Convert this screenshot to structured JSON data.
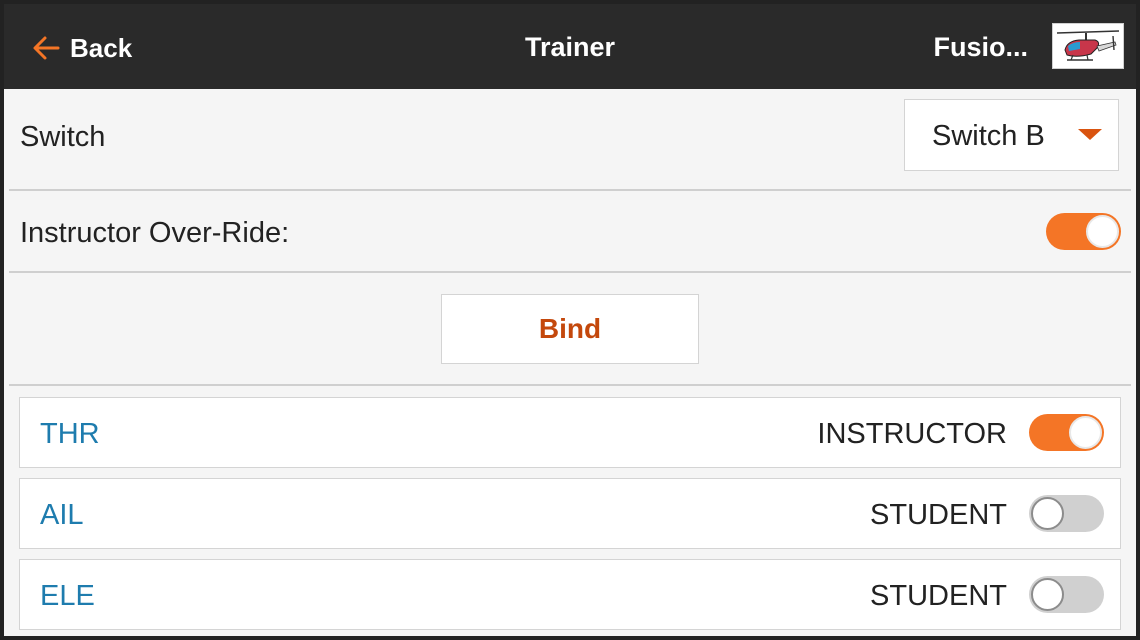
{
  "header": {
    "back_label": "Back",
    "title": "Trainer",
    "model_name": "Fusio...",
    "model_image_icon": "helicopter-icon"
  },
  "switch_row": {
    "label": "Switch",
    "selected": "Switch B"
  },
  "override_row": {
    "label": "Instructor Over-Ride:",
    "enabled": true
  },
  "bind": {
    "label": "Bind"
  },
  "channels": [
    {
      "name": "THR",
      "mode": "INSTRUCTOR",
      "enabled": true
    },
    {
      "name": "AIL",
      "mode": "STUDENT",
      "enabled": false
    },
    {
      "name": "ELE",
      "mode": "STUDENT",
      "enabled": false
    }
  ],
  "colors": {
    "accent": "#f47526",
    "accent_dark": "#c4480c",
    "channel_blue": "#1e7cae",
    "header_bg": "#2a2a2a"
  }
}
